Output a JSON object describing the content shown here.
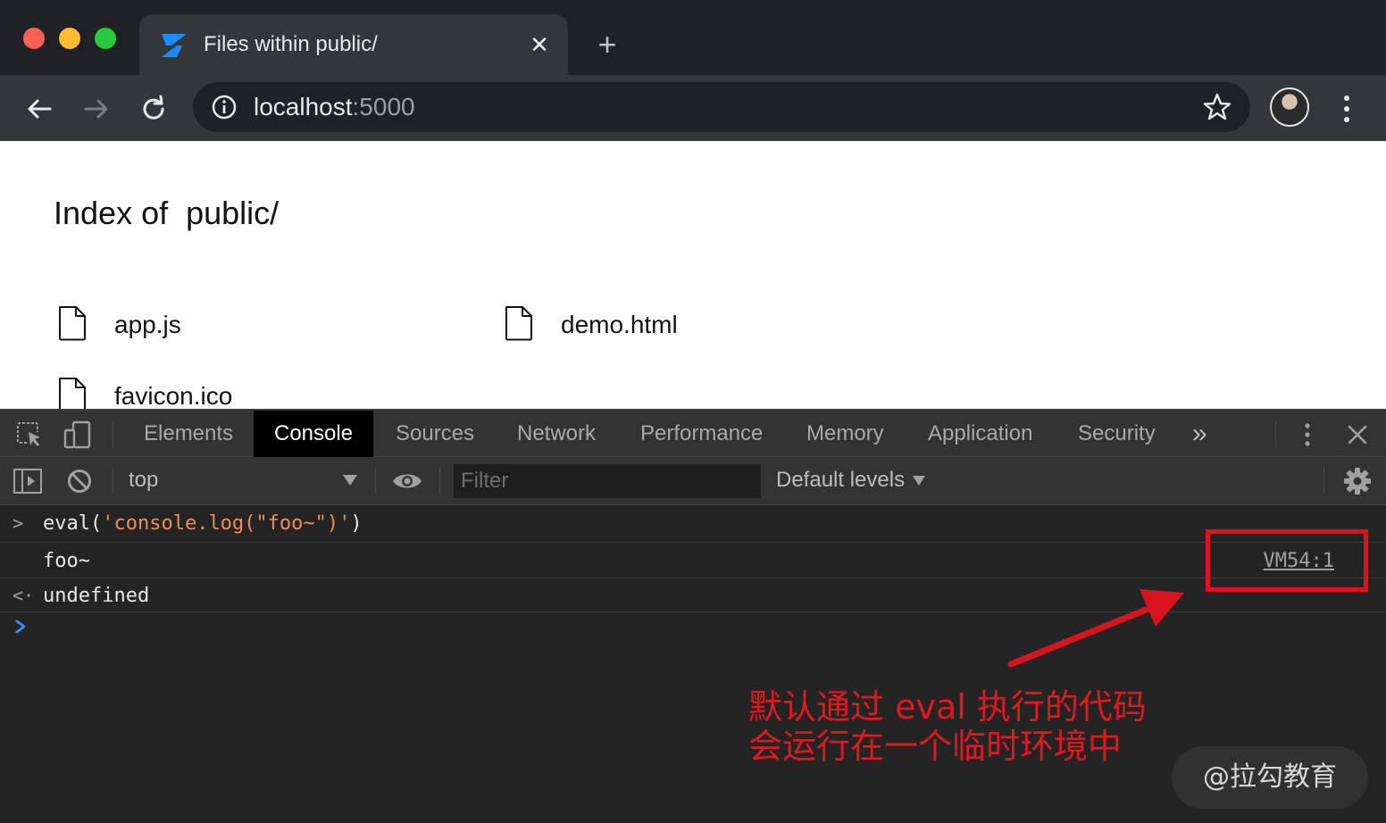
{
  "window": {
    "controls": [
      "close",
      "minimize",
      "maximize"
    ]
  },
  "tab": {
    "title": "Files within public/",
    "close_glyph": "✕",
    "new_tab_glyph": "+",
    "favicon": "zeit-logo-icon"
  },
  "toolbar": {
    "url_host": "localhost",
    "url_port": ":5000"
  },
  "page": {
    "title": "Index of  public/",
    "files": [
      {
        "name": "app.js",
        "icon": "file-icon"
      },
      {
        "name": "demo.html",
        "icon": "file-icon"
      },
      {
        "name": "favicon.ico",
        "icon": "file-icon"
      }
    ]
  },
  "devtools": {
    "tabs": [
      "Elements",
      "Console",
      "Sources",
      "Network",
      "Performance",
      "Memory",
      "Application",
      "Security"
    ],
    "active_tab": "Console",
    "more_tabs_glyph": "»",
    "context": "top",
    "filter_placeholder": "Filter",
    "levels": "Default levels"
  },
  "console": {
    "input_fn": "eval(",
    "input_arg": "'console.log(\"foo~\")'",
    "input_close": ")",
    "log_output": "foo~",
    "log_source": "VM54:1",
    "return_value": "undefined"
  },
  "annotation": {
    "text_line1": "默认通过 eval 执行的代码",
    "text_line2": "会运行在一个临时环境中",
    "watermark": "@拉勾教育",
    "color": "#e01820"
  }
}
